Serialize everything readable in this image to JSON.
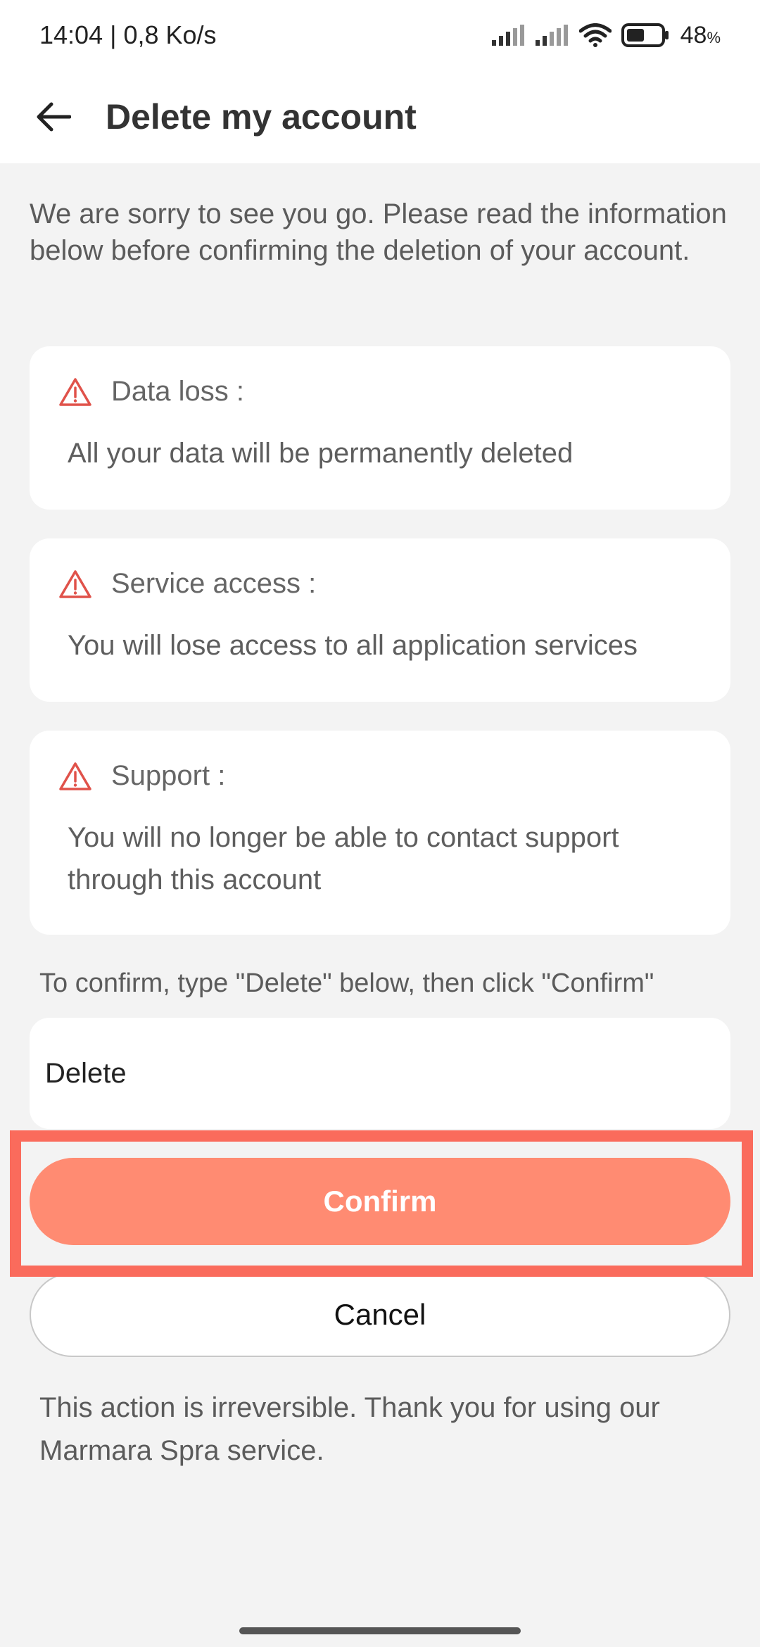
{
  "status_bar": {
    "time_speed": "14:04 | 0,8 Ko/s",
    "battery_level": "48",
    "battery_unit": "%",
    "icons": [
      "signal-icon",
      "signal-icon",
      "wifi-icon",
      "battery-icon"
    ]
  },
  "header": {
    "title": "Delete my account",
    "back_icon": "arrow-left-icon"
  },
  "intro": "We are sorry to see you go. Please read the information below before confirming the deletion of your account.",
  "cards": [
    {
      "icon": "warning-icon",
      "title": "Data loss :",
      "body": "All your data will be permanently deleted"
    },
    {
      "icon": "warning-icon",
      "title": "Service access :",
      "body": "You will lose access to all application services"
    },
    {
      "icon": "warning-icon",
      "title": "Support :",
      "body": "You will no longer be able to contact support through this account"
    }
  ],
  "confirm_hint": "To confirm, type \"Delete\" below, then click \"Confirm\"",
  "input": {
    "value": "Delete"
  },
  "buttons": {
    "confirm": "Confirm",
    "cancel": "Cancel"
  },
  "footer": "This action is irreversible. Thank you for using our Marmara Spra service.",
  "colors": {
    "accent": "#ff8b72",
    "warning": "#e0524a",
    "highlight": "#fa6b5c",
    "background": "#f3f3f3"
  }
}
